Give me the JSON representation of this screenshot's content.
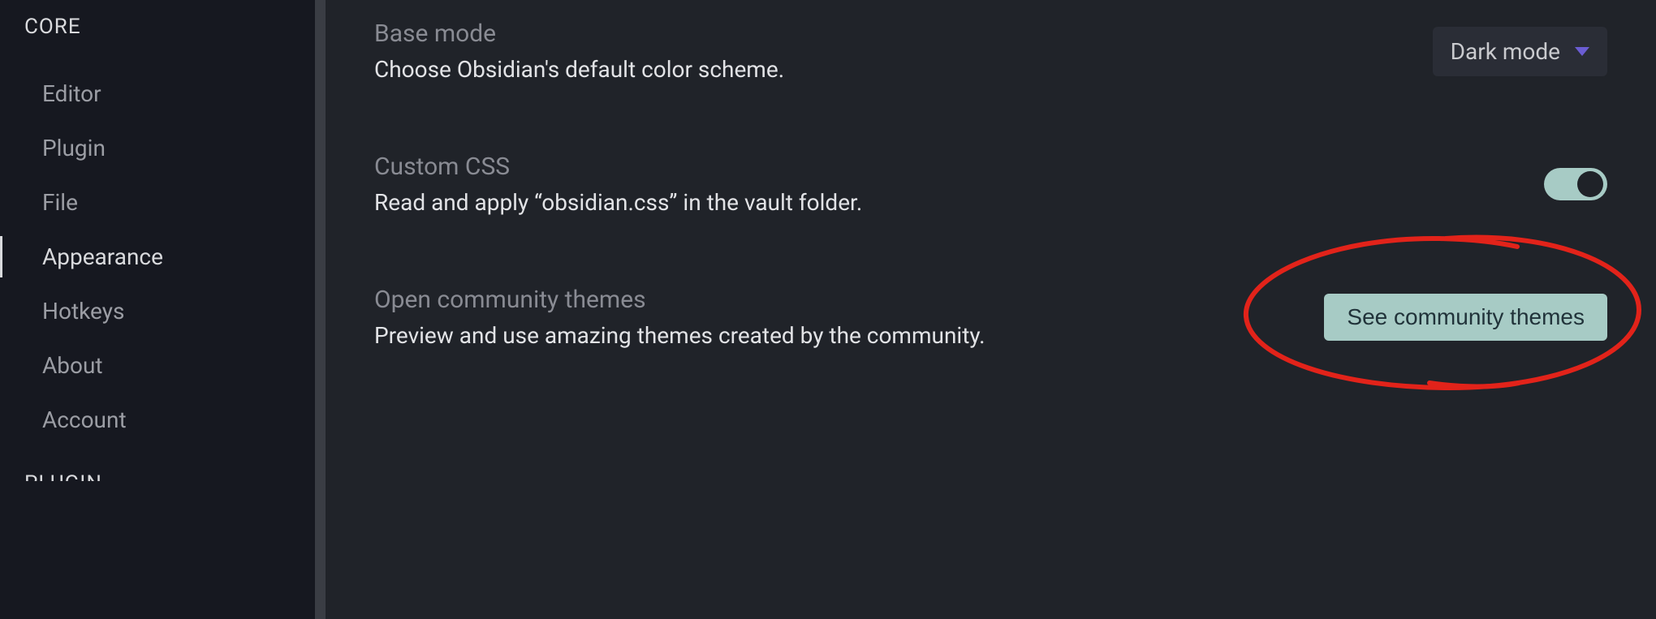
{
  "sidebar": {
    "section1_label": "CORE",
    "items": [
      {
        "label": "Editor",
        "active": false
      },
      {
        "label": "Plugin",
        "active": false
      },
      {
        "label": "File",
        "active": false
      },
      {
        "label": "Appearance",
        "active": true
      },
      {
        "label": "Hotkeys",
        "active": false
      },
      {
        "label": "About",
        "active": false
      },
      {
        "label": "Account",
        "active": false
      }
    ],
    "section2_label": "PLUGIN"
  },
  "settings": {
    "base_mode": {
      "title": "Base mode",
      "desc": "Choose Obsidian's default color scheme.",
      "selected": "Dark mode"
    },
    "custom_css": {
      "title": "Custom CSS",
      "desc": "Read and apply “obsidian.css” in the vault folder.",
      "enabled": true
    },
    "community_themes": {
      "title": "Open community themes",
      "desc": "Preview and use amazing themes created by the community.",
      "button_label": "See community themes"
    }
  }
}
